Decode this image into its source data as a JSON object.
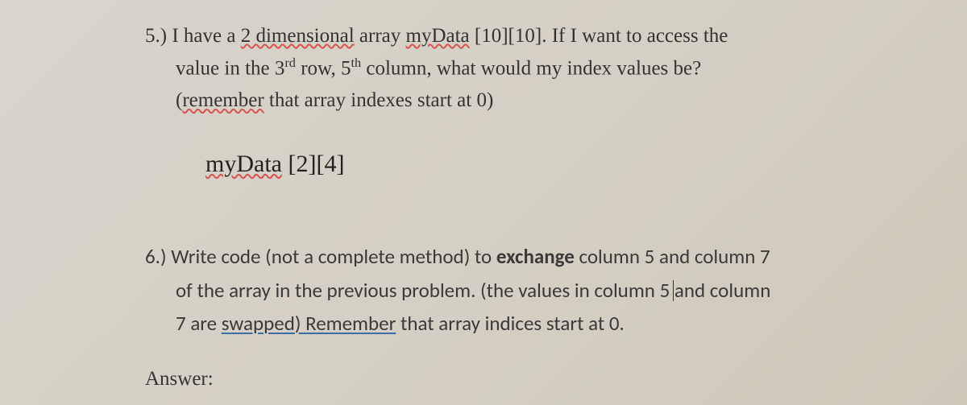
{
  "q5": {
    "number": "5.)",
    "text_part1": "I have a ",
    "underlined1": "2 dimensional",
    "text_part2": " array ",
    "underlined2": "myData",
    "text_part3": " [10][10].  If I want to access the",
    "text_line2a": "value in the 3",
    "sup1": "rd",
    "text_line2b": " row, 5",
    "sup2": "th",
    "text_line2c": " column, what would my index values be?",
    "text_line3a": "(",
    "underlined3": "remember",
    "text_line3b": " that array indexes start at 0)",
    "answer_underlined": "myData",
    "answer_rest": " [2][4]"
  },
  "q6": {
    "number": "6.)",
    "text_part1": " Write code (not a complete method) to ",
    "bold1": "exchange",
    "text_part2": " column 5 and column 7",
    "text_line2": "of the array in the previous problem.  (the values in column 5 ",
    "and_word": "and",
    "text_line2b": " column",
    "text_line3a": "7 are ",
    "underlined1": "swapped)  Remember",
    "text_line3b": " that array indices start at 0.",
    "answer_label": "Answer:"
  }
}
